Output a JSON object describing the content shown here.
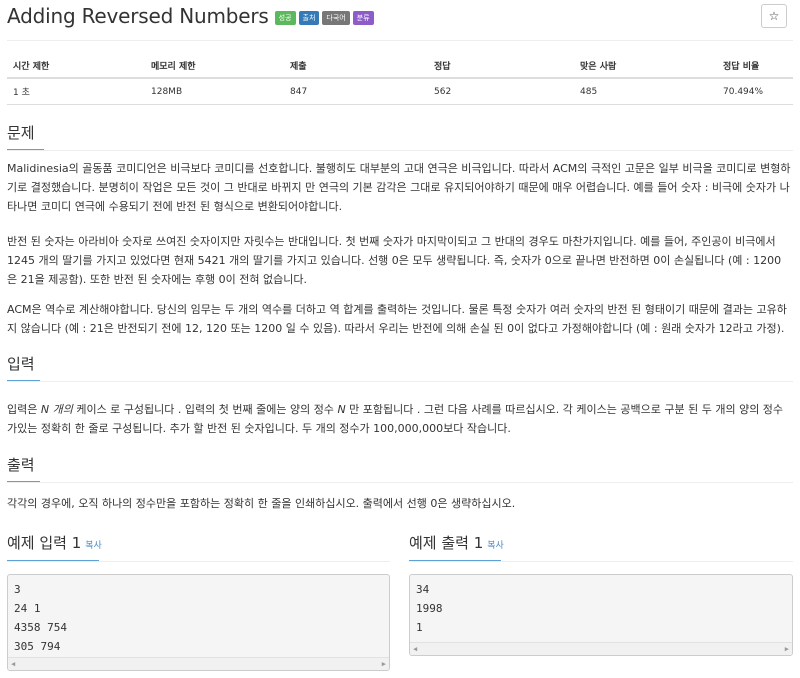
{
  "problem": {
    "title": "Adding Reversed Numbers",
    "badges": [
      {
        "label": "성공",
        "color": "#5cb85c"
      },
      {
        "label": "출처",
        "color": "#337ab7"
      },
      {
        "label": "다국어",
        "color": "#777777"
      },
      {
        "label": "분류",
        "color": "#8e5cc8"
      }
    ],
    "star": "☆"
  },
  "stats": {
    "headers": [
      "시간 제한",
      "메모리 제한",
      "제출",
      "정답",
      "맞은 사람",
      "정답 비율"
    ],
    "values": [
      "1 초",
      "128MB",
      "847",
      "562",
      "485",
      "70.494%"
    ]
  },
  "sections": {
    "problem_heading": "문제",
    "problem_paragraphs": [
      "Malidinesia의 골동품 코미디언은 비극보다 코미디를 선호합니다. 불행히도 대부분의 고대 연극은 비극입니다. 따라서 ACM의 극적인 고문은 일부 비극을 코미디로 변형하기로 결정했습니다. 분명히이 작업은 모든 것이 그 반대로 바뀌지 만 연극의 기본 감각은 그대로 유지되어야하기 때문에 매우 어렵습니다. 예를 들어 숫자 : 비극에 숫자가 나타나면 코미디 연극에 수용되기 전에 반전 된 형식으로 변환되어야합니다.",
      "반전 된 숫자는 아라비아 숫자로 쓰여진 숫자이지만 자릿수는 반대입니다. 첫 번째 숫자가 마지막이되고 그 반대의 경우도 마찬가지입니다. 예를 들어, 주인공이 비극에서 1245 개의 딸기를 가지고 있었다면 현재 5421 개의 딸기를 가지고 있습니다. 선행 0은 모두 생략됩니다. 즉, 숫자가 0으로 끝나면 반전하면 0이 손실됩니다 (예 : 1200은 21을 제공함). 또한 반전 된 숫자에는 후행 0이 전혀 없습니다.",
      "ACM은 역수로 계산해야합니다. 당신의 임무는 두 개의 역수를 더하고 역 합계를 출력하는 것입니다. 물론 특정 숫자가 여러 숫자의 반전 된 형태이기 때문에 결과는 고유하지 않습니다 (예 : 21은 반전되기 전에 12, 120 또는 1200 일 수 있음). 따라서 우리는 반전에 의해 손실 된 0이 없다고 가정해야합니다 (예 : 원래 숫자가 12라고 가정)."
    ],
    "input_heading": "입력",
    "input_text": {
      "a": "입력은 ",
      "b": "N 개의",
      "c": " 케이스 로 구성됩니다  . 입력의 첫 번째 줄에는 양의 정수 ",
      "d": "N",
      "e": " 만 포함됩니다  . 그런 다음 사례를 따르십시오. 각 케이스는 공백으로 구분 된 두 개의 양의 정수가있는 정확히 한 줄로 구성됩니다. 추가 할 반전 된 숫자입니다. 두 개의 정수가 100,000,000보다 작습니다."
    },
    "output_heading": "출력",
    "output_text": "각각의 경우에, 오직 하나의 정수만을 포함하는 정확히 한 줄을 인쇄하십시오. 출력에서 선행 0은 생략하십시오."
  },
  "samples": {
    "input_title": "예제 입력 1",
    "output_title": "예제 출력 1",
    "copy_label": "복사",
    "input_lines": [
      "3",
      "24 1",
      "4358 754",
      "305 794"
    ],
    "output_lines": [
      "34",
      "1998",
      "1"
    ]
  }
}
